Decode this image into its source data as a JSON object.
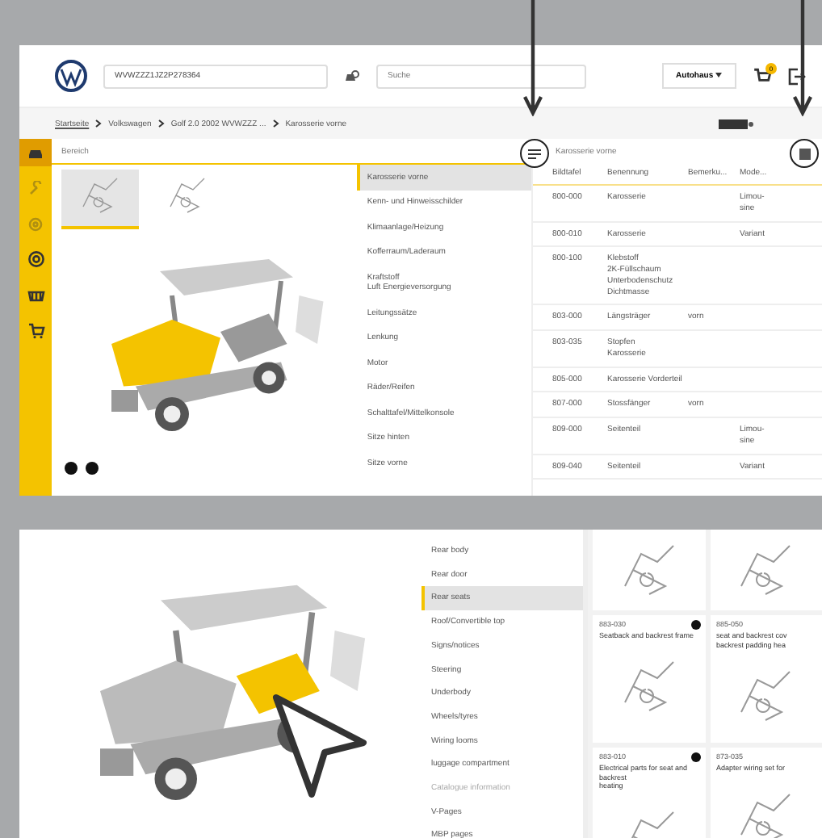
{
  "header": {
    "vin": "WVWZZZ1JZ2P278364",
    "search": {
      "placeholder": "Suche"
    },
    "dealer": "Autohaus",
    "cart_count": "0"
  },
  "breadcrumb": [
    {
      "label": "Startseite",
      "link": true
    },
    {
      "label": "Volkswagen",
      "link": false
    },
    {
      "label": "Golf 2.0 2002 WVWZZZ ...",
      "link": false
    },
    {
      "label": "Karosserie vorne",
      "link": false
    }
  ],
  "sidebar": {
    "items": [
      {
        "kind": "car",
        "selected": true,
        "disabled": false
      },
      {
        "kind": "wrench",
        "selected": false,
        "disabled": true
      },
      {
        "kind": "gear",
        "selected": false,
        "disabled": true
      },
      {
        "kind": "tire",
        "selected": false,
        "disabled": false
      },
      {
        "kind": "basket",
        "selected": false,
        "disabled": false
      },
      {
        "kind": "cart",
        "selected": false,
        "disabled": false
      }
    ]
  },
  "area": {
    "label": "Bereich",
    "thumbnails": [
      {
        "selected": true
      },
      {
        "selected": false
      }
    ]
  },
  "groups": [
    {
      "label": "Karosserie vorne",
      "selected": true
    },
    {
      "label": "Kenn- und Hinweisschilder",
      "selected": false
    },
    {
      "label": "Klimaanlage/Heizung",
      "selected": false
    },
    {
      "label": "Kofferraum/Laderaum",
      "selected": false
    },
    {
      "label": "Kraftstoff\nLuft Energieversorgung",
      "selected": false
    },
    {
      "label": "Leitungssätze",
      "selected": false
    },
    {
      "label": "Lenkung",
      "selected": false
    },
    {
      "label": "Motor",
      "selected": false
    },
    {
      "label": "Räder/Reifen",
      "selected": false
    },
    {
      "label": "Schalttafel/Mittelkonsole",
      "selected": false
    },
    {
      "label": "Sitze hinten",
      "selected": false
    },
    {
      "label": "Sitze vorne",
      "selected": false
    }
  ],
  "table": {
    "title": "Karosserie vorne",
    "columns": [
      "Bildtafel",
      "Benennung",
      "Bemerku...",
      "Mode..."
    ],
    "rows": [
      [
        "800-000",
        "Karosserie",
        "",
        "Limou-\nsine"
      ],
      [
        "800-010",
        "Karosserie",
        "",
        "Variant"
      ],
      [
        "800-100",
        "Klebstoff\n2K-Füllschaum\nUnterbodenschutz\nDichtmasse",
        "",
        ""
      ],
      [
        "803-000",
        "Längsträger",
        "vorn",
        ""
      ],
      [
        "803-035",
        "Stopfen\nKarosserie",
        "",
        ""
      ],
      [
        "805-000",
        "Karosserie Vorderteil",
        "",
        ""
      ],
      [
        "807-000",
        "Stossfänger",
        "vorn",
        ""
      ],
      [
        "809-000",
        "Seitenteil",
        "",
        "Limou-\nsine"
      ],
      [
        "809-040",
        "Seitenteil",
        "",
        "Variant"
      ]
    ]
  },
  "bottom": {
    "groups": [
      {
        "label": "Rear body",
        "selected": false,
        "disabled": false
      },
      {
        "label": "Rear door",
        "selected": false,
        "disabled": false
      },
      {
        "label": "Rear seats",
        "selected": true,
        "disabled": false
      },
      {
        "label": "Roof/Convertible top",
        "selected": false,
        "disabled": false
      },
      {
        "label": "Signs/notices",
        "selected": false,
        "disabled": false
      },
      {
        "label": "Steering",
        "selected": false,
        "disabled": false
      },
      {
        "label": "Underbody",
        "selected": false,
        "disabled": false
      },
      {
        "label": "Wheels/tyres",
        "selected": false,
        "disabled": false
      },
      {
        "label": "Wiring looms",
        "selected": false,
        "disabled": false
      },
      {
        "label": "luggage compartment",
        "selected": false,
        "disabled": false
      },
      {
        "label": "Catalogue information",
        "selected": false,
        "disabled": true
      },
      {
        "label": "V-Pages",
        "selected": false,
        "disabled": false
      },
      {
        "label": "MBP pages",
        "selected": false,
        "disabled": false
      }
    ],
    "cards": [
      {
        "number": "883-030",
        "title": "Seatback and backrest frame",
        "info": true
      },
      {
        "number": "885-050",
        "title": "seat and backrest cov\nbackrest padding hea",
        "info": false
      },
      {
        "number": "883-010",
        "title": "Electrical parts for seat and backrest\nheating",
        "info": true
      },
      {
        "number": "873-035",
        "title": "Adapter wiring set for",
        "info": false
      }
    ]
  }
}
